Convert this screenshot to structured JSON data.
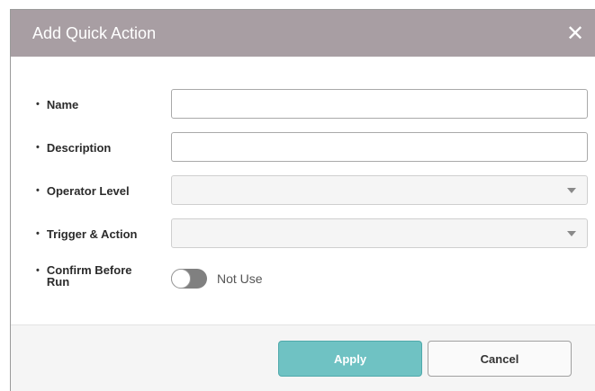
{
  "dialog": {
    "title": "Add Quick Action",
    "close_glyph": "✕"
  },
  "form": {
    "bullet": "•",
    "name": {
      "label": "Name",
      "value": ""
    },
    "description": {
      "label": "Description",
      "value": ""
    },
    "operator_level": {
      "label": "Operator Level",
      "selected": ""
    },
    "trigger_action": {
      "label": "Trigger & Action",
      "selected": ""
    },
    "confirm_before_run": {
      "label_line1": "Confirm Before",
      "label_line2": "Run",
      "state_text": "Not Use",
      "enabled": false
    }
  },
  "footer": {
    "apply_label": "Apply",
    "cancel_label": "Cancel"
  },
  "colors": {
    "header_bg": "#a89ea3",
    "apply_bg": "#6fc2c3",
    "toggle_off": "#808080"
  }
}
